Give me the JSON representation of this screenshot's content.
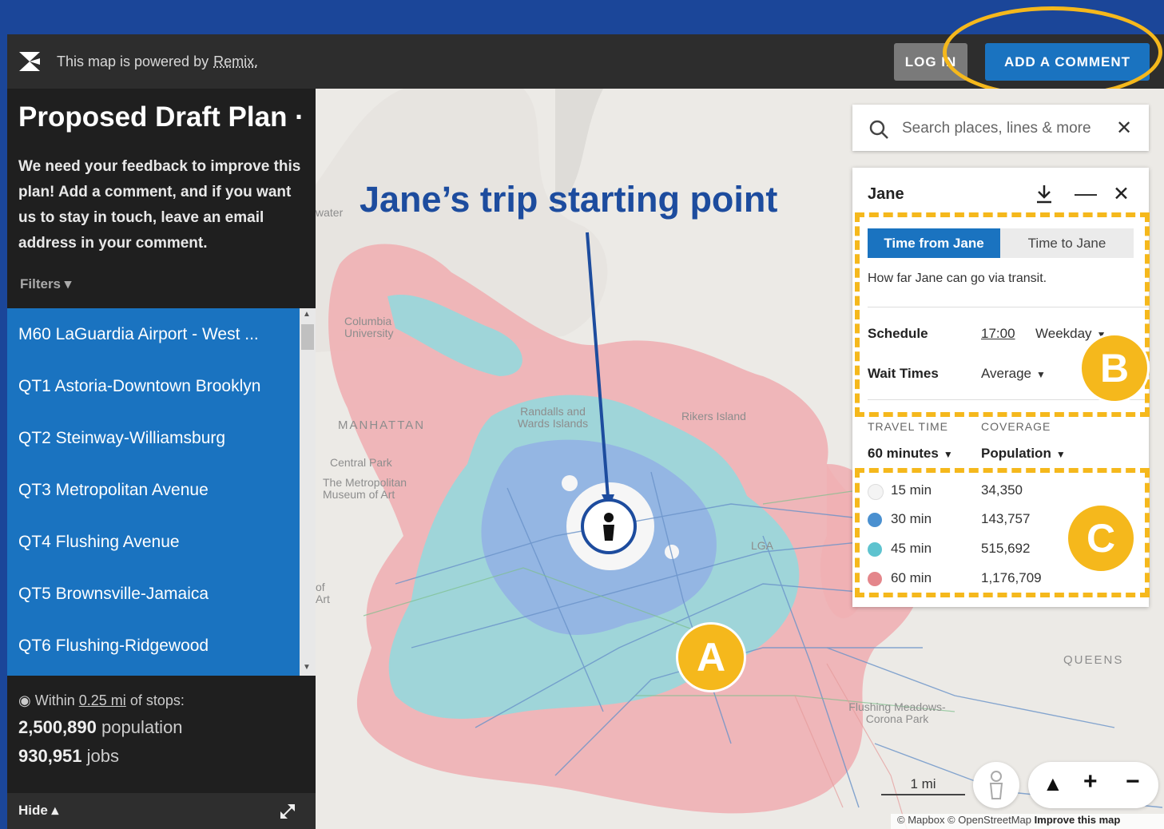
{
  "header": {
    "powered_text": "This map is powered by",
    "powered_link": "Remix.",
    "login_label": "LOG IN",
    "add_comment_label": "ADD A COMMENT"
  },
  "sidebar": {
    "title": "Proposed Draft Plan ·",
    "description": "We need your feedback to improve this plan! Add a comment, and if you want us to stay in touch, leave an email address in your comment.",
    "filters_label": "Filters",
    "routes": [
      {
        "label": "M60 LaGuardia Airport - West ..."
      },
      {
        "label": "QT1 Astoria-Downtown Brooklyn"
      },
      {
        "label": "QT2 Steinway-Williamsburg"
      },
      {
        "label": "QT3 Metropolitan Avenue"
      },
      {
        "label": "QT4 Flushing Avenue"
      },
      {
        "label": "QT5 Brownsville-Jamaica"
      },
      {
        "label": "QT6 Flushing-Ridgewood"
      }
    ],
    "stats": {
      "within_prefix": "Within",
      "distance": "0.25 mi",
      "within_suffix": "of stops:",
      "population_value": "2,500,890",
      "population_label": "population",
      "jobs_value": "930,951",
      "jobs_label": "jobs"
    },
    "hide_label": "Hide"
  },
  "map": {
    "annotation_title": "Jane’s trip starting point",
    "marker_a": "A",
    "marker_b": "B",
    "marker_c": "C",
    "labels": {
      "water": "water",
      "columbia": "Columbia University",
      "manhattan": "MANHATTAN",
      "randalls": "Randalls and Wards Islands",
      "rikers": "Rikers Island",
      "central_park": "Central Park",
      "met": "The Metropolitan Museum of Art",
      "lga": "LGA",
      "of_art": "of Art",
      "queens": "QUEENS",
      "flushing": "Flushing Meadows-Corona Park"
    },
    "scale_label": "1 mi",
    "attribution_1": "© Mapbox © OpenStreetMap",
    "attribution_2": "Improve this map"
  },
  "search": {
    "placeholder": "Search places, lines & more"
  },
  "panel": {
    "title": "Jane",
    "tab_active": "Time from Jane",
    "tab_inactive": "Time to Jane",
    "description": "How far Jane can go via transit.",
    "schedule_label": "Schedule",
    "schedule_time": "17:00",
    "schedule_day": "Weekday",
    "wait_label": "Wait Times",
    "wait_value": "Average",
    "travel_time_caption": "TRAVEL TIME",
    "coverage_caption": "COVERAGE",
    "travel_time_value": "60 minutes",
    "coverage_value": "Population",
    "legend": [
      {
        "label": "15 min",
        "value": "34,350",
        "color": "#f4f4f4"
      },
      {
        "label": "30 min",
        "value": "143,757",
        "color": "#4a90d0"
      },
      {
        "label": "45 min",
        "value": "515,692",
        "color": "#5ec3cf"
      },
      {
        "label": "60 min",
        "value": "1,176,709",
        "color": "#e4868b"
      }
    ]
  },
  "colors": {
    "brand_blue": "#1a73c0",
    "highlight": "#f5b81c",
    "background": "#1b4699"
  }
}
